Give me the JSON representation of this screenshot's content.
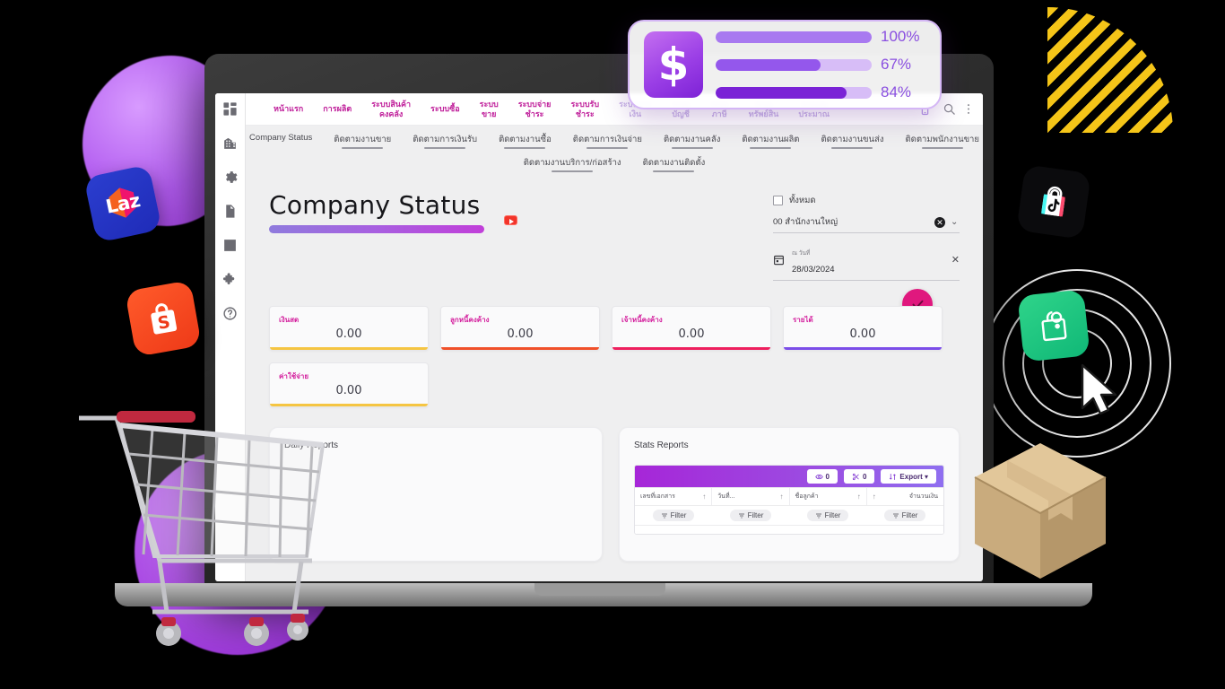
{
  "app": {
    "sidebar": {
      "items": [
        {
          "name": "dashboard-icon",
          "label": "Dashboard"
        },
        {
          "name": "building-icon",
          "label": "Organization"
        },
        {
          "name": "gear-icon",
          "label": "Settings"
        },
        {
          "name": "document-icon",
          "label": "Documents"
        },
        {
          "name": "chart-icon",
          "label": "Reports"
        },
        {
          "name": "puzzle-icon",
          "label": "Add-ons"
        },
        {
          "name": "help-icon",
          "label": "Help"
        }
      ]
    },
    "topnav": {
      "items": [
        {
          "label": "หน้าแรก",
          "faded": false
        },
        {
          "label": "การผลิต",
          "faded": false
        },
        {
          "label": "ระบบสินค้า\nคงคลัง",
          "faded": false
        },
        {
          "label": "ระบบซื้อ",
          "faded": false
        },
        {
          "label": "ระบบ\nขาย",
          "faded": false
        },
        {
          "label": "ระบบจ่าย\nชำระ",
          "faded": false
        },
        {
          "label": "ระบบรับ\nชำระ",
          "faded": false
        },
        {
          "label": "ระบบการ\nเงิน",
          "faded": true
        },
        {
          "label": "ระบบ\nบัญชี",
          "faded": true
        },
        {
          "label": "ระบบ\nภาษี",
          "faded": true
        },
        {
          "label": "ระบบ\nทรัพย์สิน",
          "faded": true
        },
        {
          "label": "ระบบงบ\nประมาณ",
          "faded": true
        }
      ],
      "right_icons": [
        {
          "name": "phone-icon"
        },
        {
          "name": "search-icon"
        },
        {
          "name": "more-vertical-icon"
        }
      ]
    },
    "tabs_row1": [
      {
        "label": "Company Status",
        "active": true
      },
      {
        "label": "ติดตามงานขาย",
        "active": false
      },
      {
        "label": "ติดตามการเงินรับ",
        "active": false
      },
      {
        "label": "ติดตามงานซื้อ",
        "active": false
      },
      {
        "label": "ติดตามการเงินจ่าย",
        "active": false
      },
      {
        "label": "ติดตามงานคลัง",
        "active": false
      },
      {
        "label": "ติดตามงานผลิต",
        "active": false
      },
      {
        "label": "ติดตามงานขนส่ง",
        "active": false
      },
      {
        "label": "ติดตามพนักงานขาย",
        "active": false
      }
    ],
    "tabs_row2": [
      {
        "label": "ติดตามงานบริการ/ก่อสร้าง",
        "active": false
      },
      {
        "label": "ติดตามงานติดตั้ง",
        "active": false
      }
    ],
    "page": {
      "title": "Company Status",
      "video_icon": "youtube-icon"
    },
    "filters": {
      "all_label": "ทั้งหมด",
      "branch_value": "00 สำนักงานใหญ่",
      "clear_symbol": "✕",
      "chevron": "⌄",
      "date_label": "ณ วันที่",
      "date_value": "28/03/2024",
      "close_symbol": "✕",
      "confirm_button": "confirm-check-button"
    },
    "kpis": [
      {
        "label": "เงินสด",
        "value": "0.00",
        "color": "#f5c542"
      },
      {
        "label": "ลูกหนี้คงค้าง",
        "value": "0.00",
        "color": "#f0502a"
      },
      {
        "label": "เจ้าหนี้คงค้าง",
        "value": "0.00",
        "color": "#ee1f5e"
      },
      {
        "label": "รายได้",
        "value": "0.00",
        "color": "#7b4de8"
      },
      {
        "label": "ค่าใช้จ่าย",
        "value": "0.00",
        "color": "#f5c542"
      }
    ],
    "panels": {
      "daily_title": "Daily Reports",
      "stats_title": "Stats Reports"
    },
    "stats_table": {
      "toolbar": [
        {
          "icon": "eye-icon",
          "label": "0"
        },
        {
          "icon": "cut-icon",
          "label": "0"
        },
        {
          "icon": "sort-icon",
          "label": "Export ▾"
        }
      ],
      "columns": [
        {
          "label": "เลขที่เอกสาร",
          "sort": "↑"
        },
        {
          "label": "วันที่...",
          "sort": "↑"
        },
        {
          "label": "ชื่อลูกค้า",
          "sort": "↑"
        },
        {
          "label": "จำนวนเงิน",
          "sort": "↑"
        }
      ],
      "filter_label": "Filter"
    }
  },
  "float_card": {
    "icon": "dollar-icon",
    "symbol": "$",
    "bars": [
      {
        "pct_label": "100%",
        "value": 100,
        "fill": "#a879f0"
      },
      {
        "pct_label": "67%",
        "value": 67,
        "fill": "#9457ec"
      },
      {
        "pct_label": "84%",
        "value": 84,
        "fill": "#7a22d6"
      }
    ]
  },
  "badges": [
    {
      "name": "lazada-badge",
      "text": "Laz"
    },
    {
      "name": "shopee-badge",
      "text": ""
    },
    {
      "name": "tiktok-shop-badge",
      "text": ""
    },
    {
      "name": "line-shopping-badge",
      "text": ""
    }
  ],
  "decor": {
    "cursor": "mouse-cursor",
    "cart": "shopping-cart",
    "parcel": "parcel-box"
  }
}
